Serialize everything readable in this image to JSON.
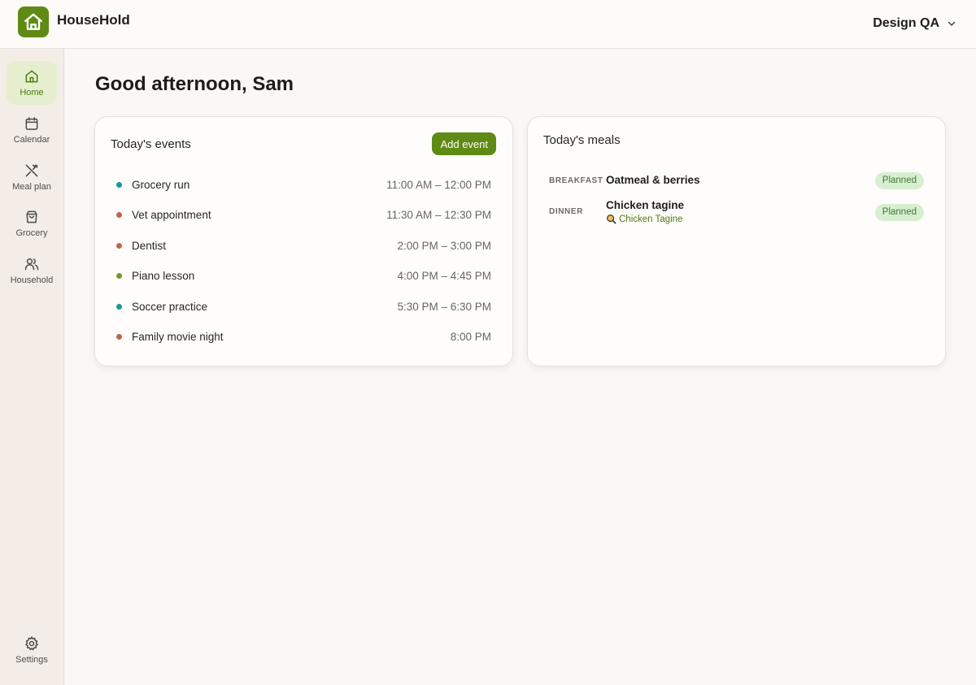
{
  "app": {
    "name": "HouseHold",
    "brand_color": "#5f8a13",
    "logo_icon": "house-icon"
  },
  "header": {
    "workspace": "Design QA",
    "workspace_icon": "chevron-down-icon"
  },
  "sidebar": {
    "items": [
      {
        "label": "Home",
        "icon": "home-icon",
        "active": true
      },
      {
        "label": "Calendar",
        "icon": "calendar-icon",
        "active": false
      },
      {
        "label": "Meal plan",
        "icon": "utensils-icon",
        "active": false
      },
      {
        "label": "Grocery",
        "icon": "shopping-bag-icon",
        "active": false
      },
      {
        "label": "Household",
        "icon": "users-icon",
        "active": false
      }
    ],
    "settings": {
      "label": "Settings",
      "icon": "gear-icon"
    }
  },
  "main": {
    "greeting": "Good afternoon, Sam",
    "events": {
      "title": "Today's events",
      "add_label": "Add event",
      "items": [
        {
          "name": "Grocery run",
          "time": "11:00 AM – 12:00 PM",
          "color": "#159a9c"
        },
        {
          "name": "Vet appointment",
          "time": "11:30 AM – 12:30 PM",
          "color": "#c0644d"
        },
        {
          "name": "Dentist",
          "time": "2:00 PM – 3:00 PM",
          "color": "#c0644d"
        },
        {
          "name": "Piano lesson",
          "time": "4:00 PM – 4:45 PM",
          "color": "#6d9a2c"
        },
        {
          "name": "Soccer practice",
          "time": "5:30 PM – 6:30 PM",
          "color": "#159a9c"
        },
        {
          "name": "Family movie night",
          "time": "8:00 PM",
          "color": "#c0644d"
        }
      ]
    },
    "meals": {
      "title": "Today's meals",
      "items": [
        {
          "type": "BREAKFAST",
          "name": "Oatmeal & berries",
          "status": "Planned"
        },
        {
          "type": "DINNER",
          "name": "Chicken tagine",
          "recipe_link": "Chicken Tagine",
          "recipe_icon": "search-icon",
          "status": "Planned"
        }
      ]
    }
  }
}
